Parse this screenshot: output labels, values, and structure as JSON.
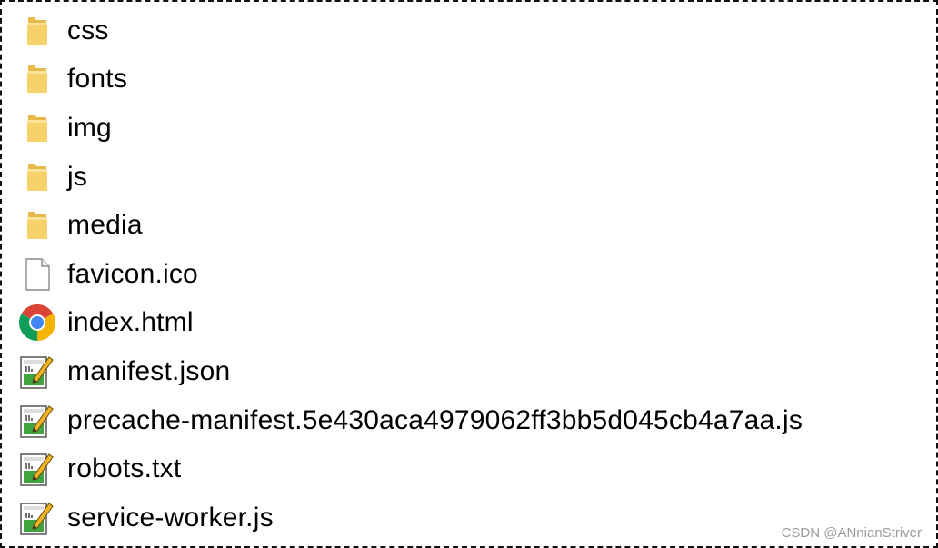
{
  "files": [
    {
      "name": "css",
      "icon": "folder-icon"
    },
    {
      "name": "fonts",
      "icon": "folder-icon"
    },
    {
      "name": "img",
      "icon": "folder-icon"
    },
    {
      "name": "js",
      "icon": "folder-icon"
    },
    {
      "name": "media",
      "icon": "folder-icon"
    },
    {
      "name": "favicon.ico",
      "icon": "blank-file-icon"
    },
    {
      "name": "index.html",
      "icon": "chrome-icon"
    },
    {
      "name": "manifest.json",
      "icon": "editor-file-icon"
    },
    {
      "name": "precache-manifest.5e430aca4979062ff3bb5d045cb4a7aa.js",
      "icon": "editor-file-icon"
    },
    {
      "name": "robots.txt",
      "icon": "editor-file-icon"
    },
    {
      "name": "service-worker.js",
      "icon": "editor-file-icon"
    }
  ],
  "watermark": "CSDN @ANnianStriver",
  "colors": {
    "folder": "#F7D26B",
    "folder_dark": "#E8B94A",
    "editor_green": "#3FA33F",
    "chrome_red": "#DB4437",
    "chrome_yellow": "#F4B400",
    "chrome_green": "#0F9D58",
    "chrome_blue": "#4285F4"
  }
}
